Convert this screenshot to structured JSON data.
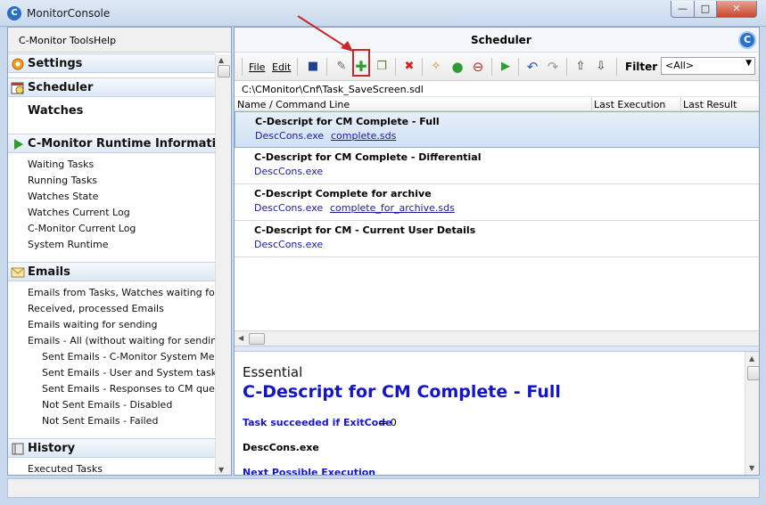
{
  "window": {
    "title": "MonitorConsole",
    "app_icon_letter": "C",
    "min_glyph": "—",
    "max_glyph": "□",
    "close_glyph": "✕"
  },
  "left_menu": {
    "tools": "C-Monitor Tools",
    "help": "Help"
  },
  "sections": {
    "settings": "Settings",
    "scheduler": "Scheduler",
    "watches": "Watches",
    "runtime": "C-Monitor Runtime Information",
    "emails": "Emails",
    "history": "History"
  },
  "runtime_items": [
    "Waiting Tasks",
    "Running Tasks",
    "Watches State",
    "Watches Current Log",
    "C-Monitor Current Log",
    "System Runtime"
  ],
  "email_items": [
    "Emails from Tasks, Watches waiting for send",
    "Received, processed Emails",
    "Emails waiting for sending",
    "Emails - All (without waiting for sending)"
  ],
  "sent_items": [
    "Sent Emails - C-Monitor System Message",
    "Sent Emails - User and System tasks Res",
    "Sent Emails - Responses to CM queries",
    "Not Sent Emails - Disabled",
    "Not Sent Emails - Failed"
  ],
  "history_items": [
    "Executed Tasks"
  ],
  "scheduler": {
    "title": "Scheduler",
    "logo_letter": "C",
    "toolbar": {
      "file": "File",
      "edit": "Edit"
    },
    "filter_label": "Filter",
    "filter_value": "<All>",
    "path": "C:\\CMonitor\\Cnf\\Task_SaveScreen.sdl",
    "columns": [
      "Name / Command Line",
      "Last Execution",
      "Last Result"
    ],
    "rows": [
      {
        "name": "C-Descript for CM Complete - Full",
        "cmd": "DescCons.exe",
        "arg": "complete.sds"
      },
      {
        "name": "C-Descript for CM Complete - Differential",
        "cmd": "DescCons.exe",
        "arg": ""
      },
      {
        "name": "C-Descript Complete for archive",
        "cmd": "DescCons.exe",
        "arg": "complete_for_archive.sds"
      },
      {
        "name": "C-Descript for CM - Current User Details",
        "cmd": "DescCons.exe",
        "arg": ""
      }
    ]
  },
  "details": {
    "heading": "Essential",
    "task_title": "C-Descript for CM Complete - Full",
    "success_label": "Task succeeded if ExitCode",
    "success_value": "= 0",
    "exe": "DescCons.exe",
    "next_label": "Next Possible Execution"
  },
  "colors": {
    "accent_blue": "#1515c8",
    "highlight_red": "#c62828",
    "link_blue": "#1a1aa0"
  }
}
